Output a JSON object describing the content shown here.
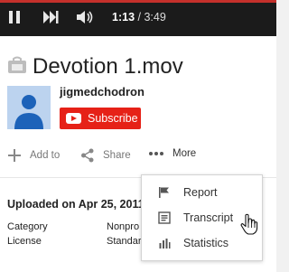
{
  "player": {
    "current_time": "1:13",
    "separator": " / ",
    "duration": "3:49"
  },
  "video": {
    "title": "Devotion 1.mov"
  },
  "channel": {
    "name": "jigmedchodron",
    "subscribe_label": "Subscribe"
  },
  "actions": {
    "add_to": "Add to",
    "share": "Share",
    "more": "More"
  },
  "details": {
    "uploaded": "Uploaded on Apr 25, 2011",
    "category_label": "Category",
    "category_value": "Nonpro",
    "license_label": "License",
    "license_value": "Standar"
  },
  "more_menu": {
    "items": [
      {
        "label": "Report",
        "icon": "flag-icon"
      },
      {
        "label": "Transcript",
        "icon": "transcript-icon"
      },
      {
        "label": "Statistics",
        "icon": "statistics-icon"
      }
    ]
  },
  "colors": {
    "brand_red": "#e62117",
    "player_bg": "#1b1b1b"
  }
}
